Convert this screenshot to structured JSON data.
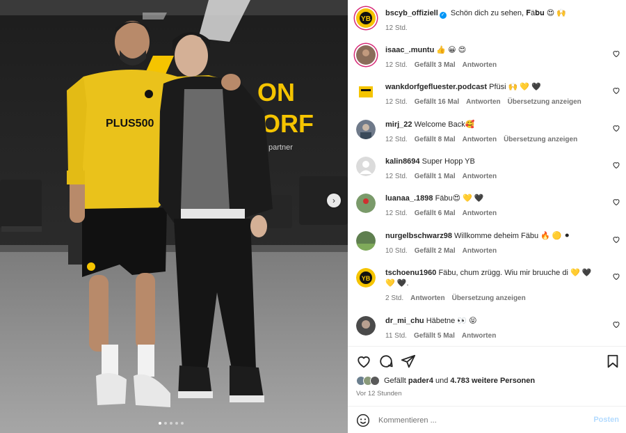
{
  "post": {
    "author": "bscyb_offiziell",
    "caption": "Schön dich zu sehen, 𝐅ä𝐛𝐮 😍 🙌",
    "time": "12 Std."
  },
  "comments": [
    {
      "user": "isaac_.muntu",
      "text": "👍 😀 😍",
      "time": "12 Std.",
      "likes": "Gefällt 3 Mal",
      "reply": "Antworten",
      "translate": "",
      "avatar_color": "#8a6d5a"
    },
    {
      "user": "wankdorfgefluester.podcast",
      "text": "Pfüsi 🙌 💛 🖤",
      "time": "12 Std.",
      "likes": "Gefällt 16 Mal",
      "reply": "Antworten",
      "translate": "Übersetzung anzeigen",
      "avatar_color": "#f5c400"
    },
    {
      "user": "mirj_22",
      "text": "Welcome Back🥰",
      "time": "12 Std.",
      "likes": "Gefällt 8 Mal",
      "reply": "Antworten",
      "translate": "Übersetzung anzeigen",
      "avatar_color": "#6f7a8a"
    },
    {
      "user": "kalin8694",
      "text": "Super Hopp YB",
      "time": "12 Std.",
      "likes": "Gefällt 1 Mal",
      "reply": "Antworten",
      "translate": "",
      "avatar_color": "#dbdbdb"
    },
    {
      "user": "luanaa_.1898",
      "text": "Fäbu😍 💛 🖤",
      "time": "12 Std.",
      "likes": "Gefällt 6 Mal",
      "reply": "Antworten",
      "translate": "",
      "avatar_color": "#7a9a6a"
    },
    {
      "user": "nurgelbschwarz98",
      "text": "Willkomme deheim Fäbu 🔥 🟡 ⚫",
      "time": "10 Std.",
      "likes": "Gefällt 2 Mal",
      "reply": "Antworten",
      "translate": "",
      "avatar_color": "#5f7f4f"
    },
    {
      "user": "tschoenu1960",
      "text": "Fäbu, chum zrügg. Wiu mir bruuche di 💛 🖤 💛 🖤.",
      "time": "2 Std.",
      "likes": "",
      "reply": "Antworten",
      "translate": "Übersetzung anzeigen",
      "avatar_color": "#f5c400"
    },
    {
      "user": "dr_mi_chu",
      "text": "Häbetne 👀 😝",
      "time": "11 Std.",
      "likes": "Gefällt 5 Mal",
      "reply": "Antworten",
      "translate": "",
      "avatar_color": "#4a4a4a"
    }
  ],
  "likes_summary": {
    "prefix": "Gefällt",
    "user": "pader4",
    "connector": "und",
    "others": "4.783 weitere Personen"
  },
  "post_time": "Vor 12 Stunden",
  "composer": {
    "placeholder": "Kommentieren ...",
    "post_label": "Posten"
  },
  "photo": {
    "jersey_text": "PLUS500",
    "wall_text": "ON\nORF",
    "wall_small": "partner"
  },
  "carousel": {
    "count": 5,
    "active": 1
  },
  "colors": {
    "yb_yellow": "#f5c400",
    "link_blue": "#0095f6",
    "meta_gray": "#737373"
  }
}
